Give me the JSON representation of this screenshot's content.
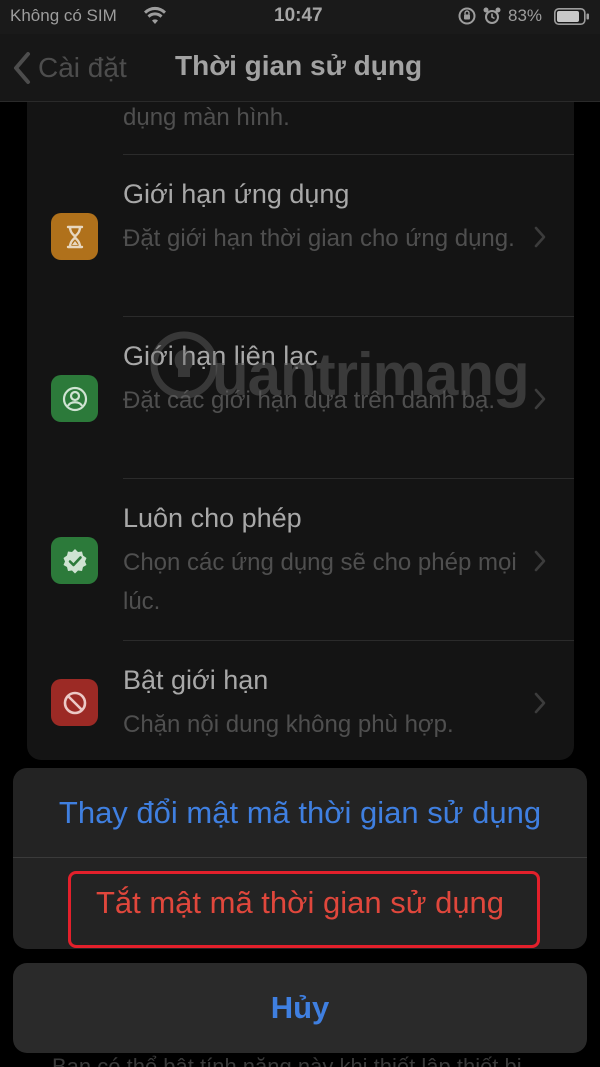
{
  "status_bar": {
    "carrier": "Không có SIM",
    "time": "10:47",
    "battery_percent": "83%",
    "icons": [
      "wifi-icon",
      "rotation-lock-icon",
      "alarm-icon",
      "battery-icon"
    ]
  },
  "nav": {
    "back_label": "Cài đặt",
    "title": "Thời gian sử dụng"
  },
  "list": {
    "partial_top_text": "dụng màn hình.",
    "items": [
      {
        "title": "Giới hạn ứng dụng",
        "subtitle": "Đặt giới hạn thời gian cho ứng dụng.",
        "icon": "hourglass-icon",
        "icon_color": "#b0711b"
      },
      {
        "title": "Giới hạn liên lạc",
        "subtitle": "Đặt các giới hạn dựa trên danh bạ.",
        "icon": "contact-icon",
        "icon_color": "#2c7a3a"
      },
      {
        "title": "Luôn cho phép",
        "subtitle": "Chọn các ứng dụng sẽ cho phép mọi lúc.",
        "icon": "checkmark-badge-icon",
        "icon_color": "#2c7a3a"
      },
      {
        "title": "Bật giới hạn",
        "subtitle": "Chặn nội dung không phù hợp.",
        "icon": "block-icon",
        "icon_color": "#9c2a25"
      }
    ]
  },
  "watermark": "uantrimang",
  "action_sheet": {
    "change_passcode": "Thay đổi mật mã thời gian sử dụng",
    "disable_passcode": "Tắt mật mã thời gian sử dụng",
    "cancel": "Hủy"
  },
  "bottom_peek_text": "Bạn có thể bật tính năng này khi thiết lập thiết bị",
  "colors": {
    "accent_blue": "#3f7fe0",
    "destructive_red": "#e0473c",
    "highlight_red": "#e3202b"
  }
}
